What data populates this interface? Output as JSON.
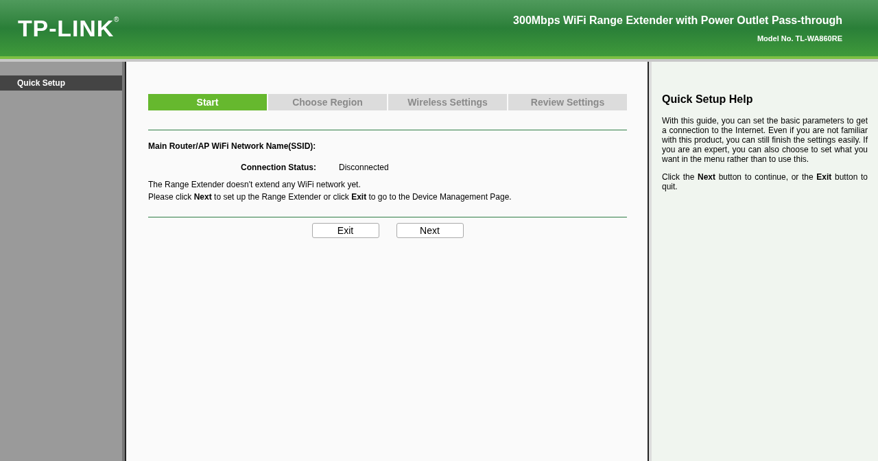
{
  "header": {
    "logo": "TP-LINK",
    "registered_mark": "®",
    "product": "300Mbps WiFi Range Extender with Power Outlet Pass-through",
    "model": "Model No. TL-WA860RE"
  },
  "sidebar": {
    "items": [
      {
        "label": "Quick Setup",
        "selected": true
      }
    ]
  },
  "steps": [
    {
      "label": "Start",
      "selected": true
    },
    {
      "label": "Choose Region",
      "selected": false
    },
    {
      "label": "Wireless Settings",
      "selected": false
    },
    {
      "label": "Review Settings",
      "selected": false
    }
  ],
  "ssid_label": "Main Router/AP WiFi Network Name(SSID):",
  "status": {
    "label": "Connection Status:",
    "value": "Disconnected"
  },
  "messages": [
    "The Range Extender doesn't extend any WiFi network yet.",
    "Please click **Next** to set up the Range Extender or click **Exit** to go to the Device Management Page."
  ],
  "buttons": [
    "Exit",
    "Next"
  ],
  "help": {
    "title": "Quick Setup Help",
    "paragraphs": [
      "With this guide, you can set the basic parameters to get a connection to the Internet. Even if you are not familiar with this product, you can still finish the settings easily. If you are an expert, you can also choose to set what you want in the menu rather than to use this.",
      "Click the **Next** button to continue, or the **Exit** button to quit."
    ]
  }
}
